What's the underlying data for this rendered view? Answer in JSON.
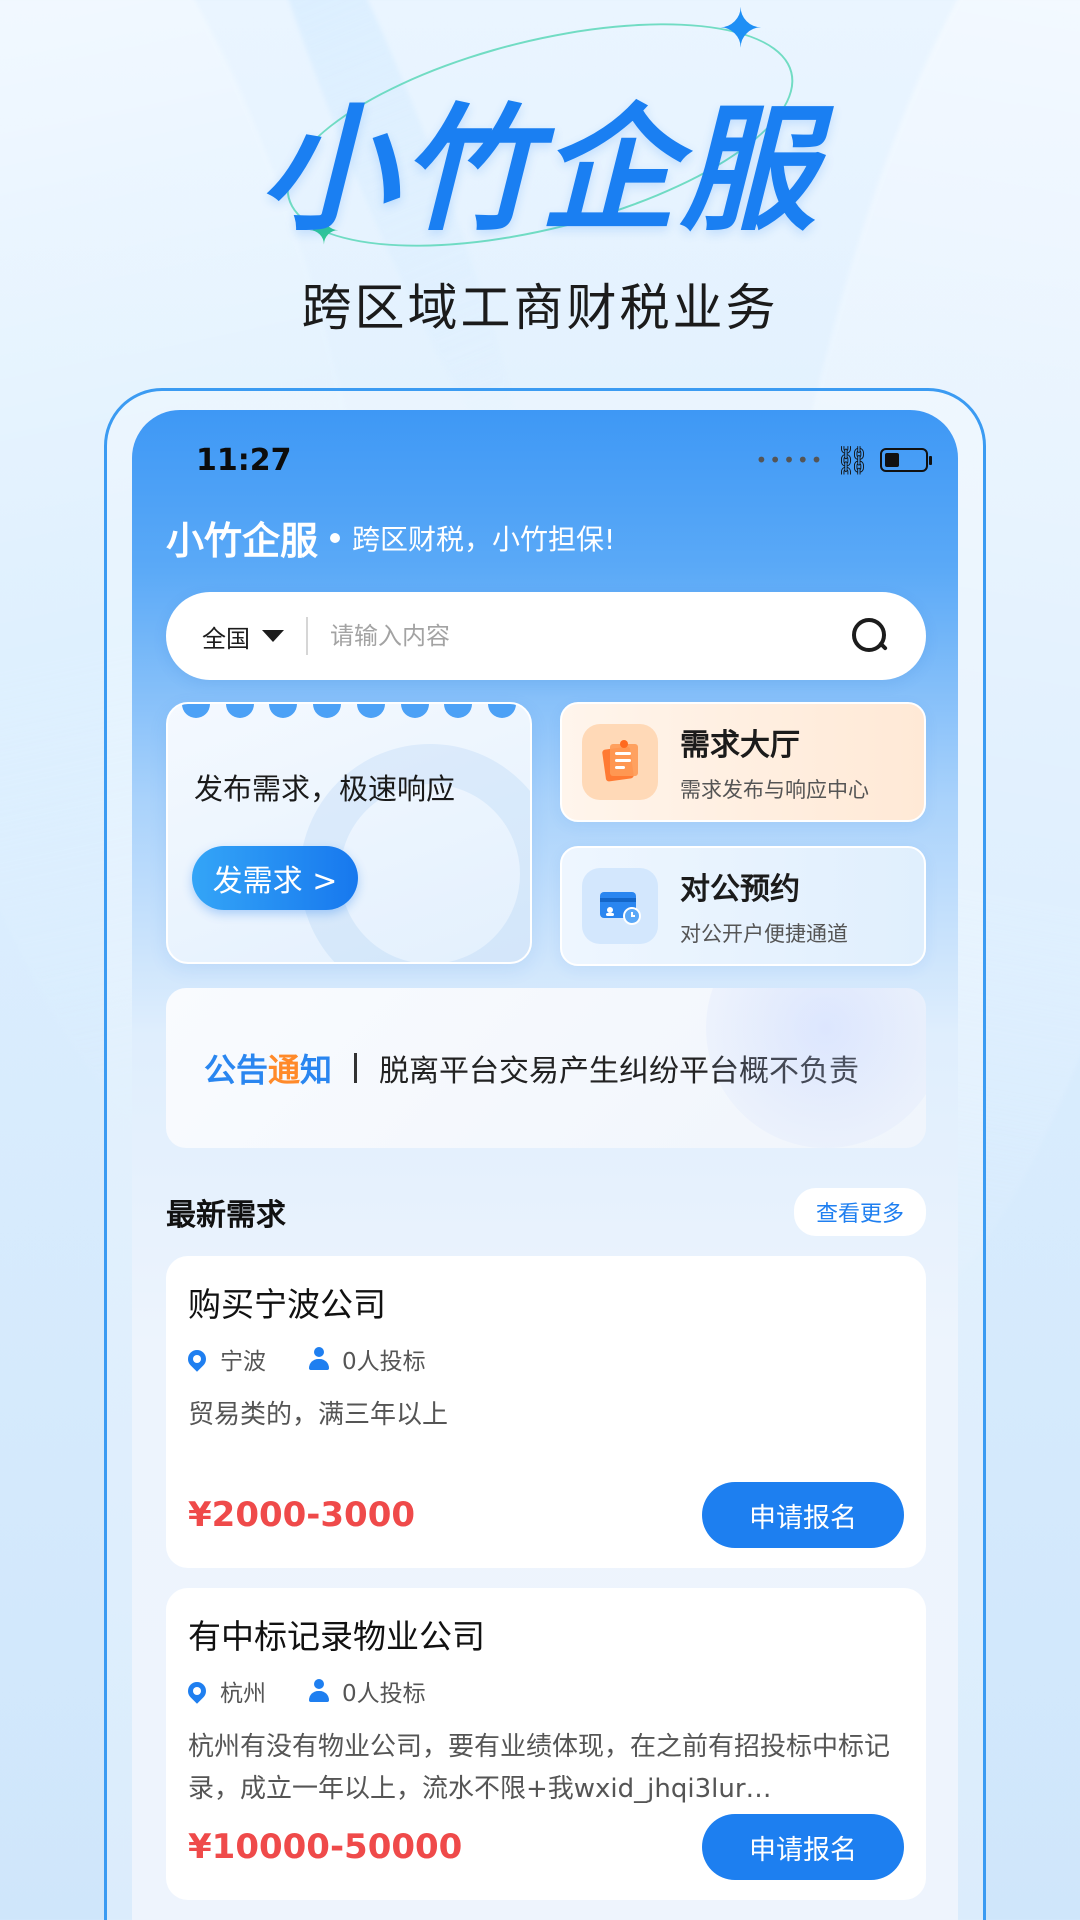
{
  "hero": {
    "title": "小竹企服",
    "subtitle": "跨区域工商财税业务"
  },
  "status_bar": {
    "time": "11:27"
  },
  "app": {
    "brand": "小竹企服",
    "slogan": "跨区财税，小竹担保!"
  },
  "search": {
    "region": "全国",
    "placeholder": "请输入内容"
  },
  "publish": {
    "text": "发布需求，极速响应",
    "button": "发需求 >"
  },
  "quick_links": [
    {
      "title": "需求大厅",
      "desc": "需求发布与响应中心",
      "icon": "clipboard-icon"
    },
    {
      "title": "对公预约",
      "desc": "对公开户便捷通道",
      "icon": "bank-card-icon"
    }
  ],
  "notice": {
    "tag_part1": "公告",
    "tag_accent": "通",
    "tag_part2": "知",
    "text": "脱离平台交易产生纠纷平台概不负责"
  },
  "latest": {
    "title": "最新需求",
    "more": "查看更多",
    "items": [
      {
        "title": "购买宁波公司",
        "city": "宁波",
        "bids": "0人投标",
        "desc": "贸易类的，满三年以上",
        "price": "¥2000-3000",
        "button": "申请报名"
      },
      {
        "title": "有中标记录物业公司",
        "city": "杭州",
        "bids": "0人投标",
        "desc": "杭州有没有物业公司，要有业绩体现，在之前有招投标中标记录，成立一年以上，流水不限+我wxid_jhqi3lur…",
        "price": "¥10000-50000",
        "button": "申请报名"
      }
    ]
  },
  "colors": {
    "primary": "#1d7ff0",
    "price": "#ef4a4a",
    "hero_title": "#1a7ff2"
  }
}
